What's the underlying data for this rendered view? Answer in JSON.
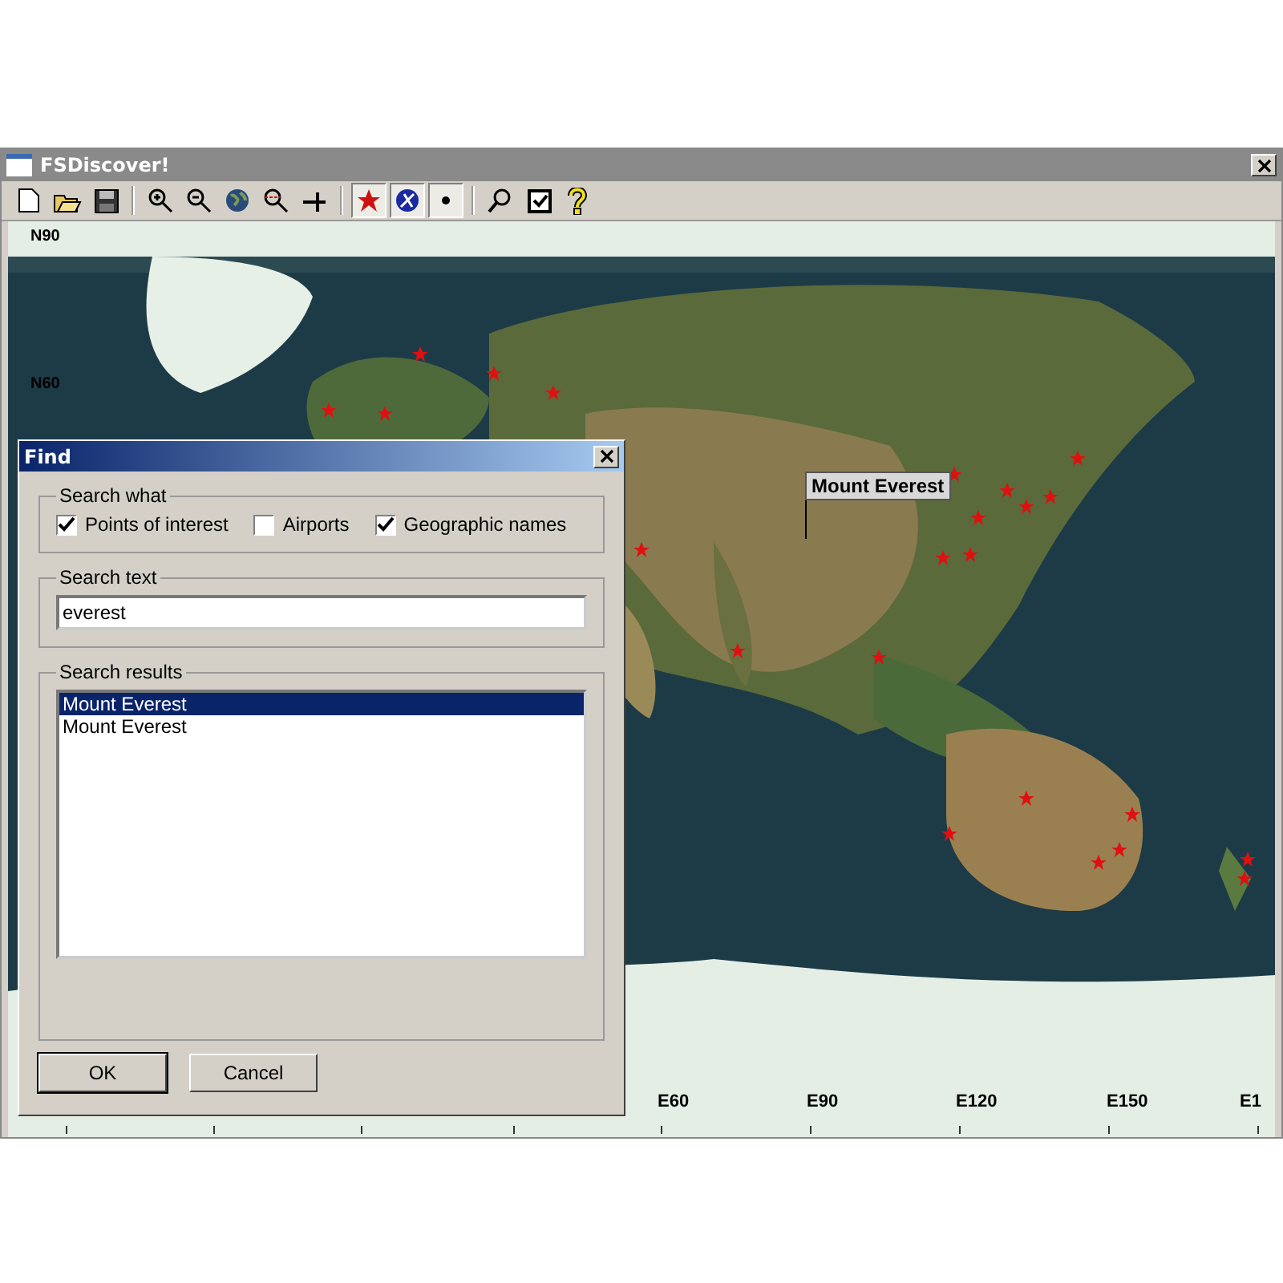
{
  "window": {
    "title": "FSDiscover!"
  },
  "toolbar": {
    "layer_toggles": [
      {
        "on": true
      },
      {
        "on": true
      },
      {
        "on": true
      }
    ]
  },
  "map": {
    "latitude_labels": [
      "N90",
      "N60"
    ],
    "longitude_labels": [
      "E60",
      "E90",
      "E120",
      "E150",
      "E1"
    ],
    "callout": "Mount Everest"
  },
  "find_dialog": {
    "title": "Find",
    "search_what": {
      "legend": "Search what",
      "options": [
        {
          "label": "Points of interest",
          "checked": true
        },
        {
          "label": "Airports",
          "checked": false
        },
        {
          "label": "Geographic names",
          "checked": true
        }
      ]
    },
    "search_text": {
      "legend": "Search text",
      "value": "everest"
    },
    "search_results": {
      "legend": "Search results",
      "items": [
        {
          "label": "Mount Everest",
          "selected": true
        },
        {
          "label": "Mount Everest",
          "selected": false
        }
      ]
    },
    "buttons": [
      "OK",
      "Cancel"
    ]
  }
}
